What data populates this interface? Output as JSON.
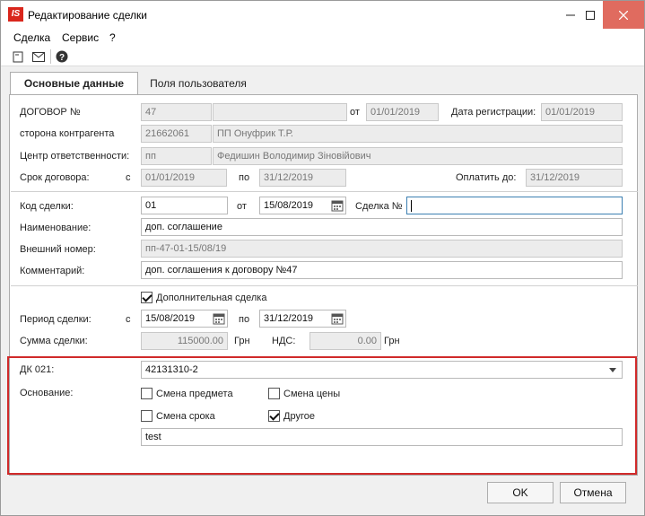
{
  "window": {
    "title": "Редактирование сделки",
    "app_icon_text": "IS"
  },
  "menu": [
    "Сделка",
    "Сервис",
    "?"
  ],
  "tabs": [
    {
      "label": "Основные данные"
    },
    {
      "label": "Поля пользователя"
    }
  ],
  "contract": {
    "number_label": "ДОГОВОР №",
    "number_value": "47",
    "number_extra": "",
    "from_label": "от",
    "from_value": "01/01/2019",
    "reg_label": "Дата регистрации:",
    "reg_value": "01/01/2019",
    "counterparty_label": "сторона контрагента",
    "counterparty_code": "21662061",
    "counterparty_name": "ПП Онуфрик Т.Р.",
    "center_label": "Центр ответственности:",
    "center_code": "пп",
    "center_name": "Федишин Володимир Зіновійович",
    "term_label": "Срок договора:",
    "term_c_label": "с",
    "term_from": "01/01/2019",
    "term_po_label": "по",
    "term_to": "31/12/2019",
    "pay_label": "Оплатить до:",
    "pay_value": "31/12/2019"
  },
  "deal": {
    "code_label": "Код сделки:",
    "code_value": "01",
    "from_label": "от",
    "date_value": "15/08/2019",
    "deal_no_label": "Сделка №",
    "deal_no_value": "",
    "name_label": "Наименование:",
    "name_value": "доп. соглашение",
    "ext_label": "Внешний номер:",
    "ext_value": "пп-47-01-15/08/19",
    "comment_label": "Комментарий:",
    "comment_value": "доп. соглашения к договору №47"
  },
  "period": {
    "extra_label": "Дополнительная сделка",
    "extra_checked": true,
    "label": "Период сделки:",
    "c_label": "с",
    "from": "15/08/2019",
    "po_label": "по",
    "to": "31/12/2019",
    "sum_label": "Сумма сделки:",
    "sum_value": "115000.00",
    "currency1": "Грн",
    "vat_label": "НДС:",
    "vat_value": "0.00",
    "currency2": "Грн"
  },
  "dk": {
    "label": "ДК 021:",
    "value": "42131310-2",
    "basis_label": "Основание:",
    "options": [
      {
        "label": "Смена предмета",
        "checked": false
      },
      {
        "label": "Смена цены",
        "checked": false
      },
      {
        "label": "Смена срока",
        "checked": false
      },
      {
        "label": "Другое",
        "checked": true
      }
    ],
    "other_text": "test"
  },
  "buttons": {
    "ok": "OK",
    "cancel": "Отмена"
  }
}
